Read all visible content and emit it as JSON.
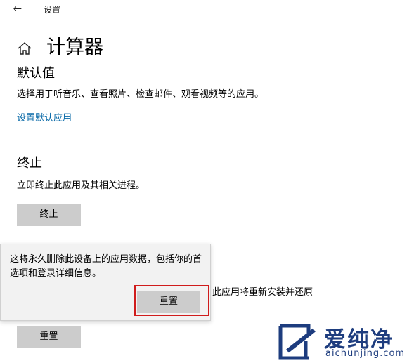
{
  "titlebar": {
    "back_icon": "back-arrow-icon",
    "title": "设置"
  },
  "header": {
    "home_icon": "home-icon",
    "title": "计算器"
  },
  "defaults": {
    "heading": "默认值",
    "description": "选择用于听音乐、查看照片、检查邮件、观看视频等的应用。",
    "link": "设置默认应用"
  },
  "terminate": {
    "heading": "终止",
    "description": "立即终止此应用及其相关进程。",
    "button": "终止"
  },
  "reset": {
    "partial_description": "此应用将重新安装并还原",
    "button": "重置"
  },
  "flyout": {
    "message": "这将永久删除此设备上的应用数据，包括你的首选项和登录详细信息。",
    "confirm_button": "重置"
  },
  "watermark": {
    "title": "爱纯净",
    "subtitle": "aichunjing.com"
  },
  "colors": {
    "link": "#0a6aa8",
    "button_bg": "#cccccc",
    "highlight": "#d01c1c",
    "watermark": "#1d3c7e"
  }
}
